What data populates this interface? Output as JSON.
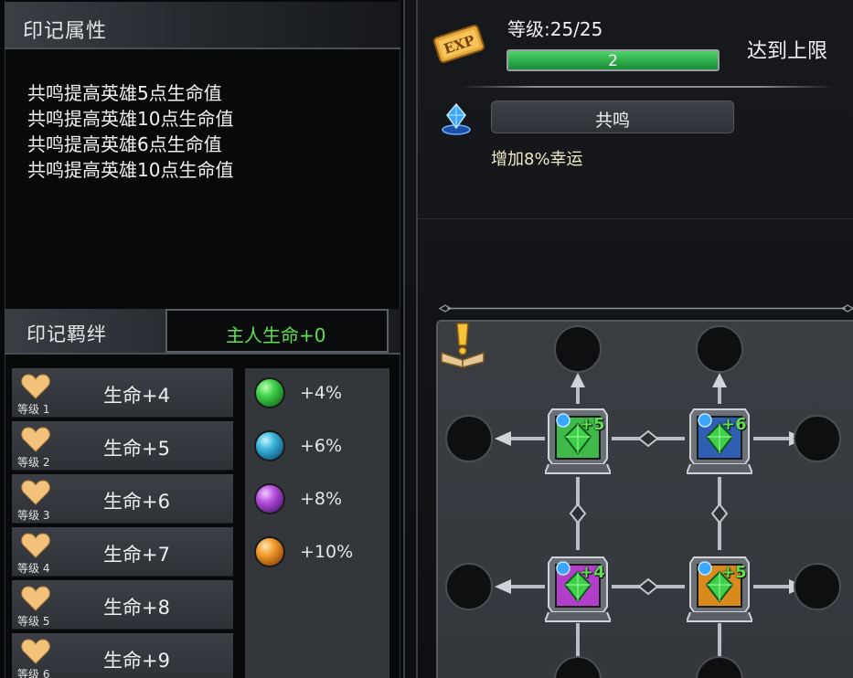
{
  "attributes": {
    "title": "印记属性",
    "lines": [
      "共鸣提高英雄5点生命值",
      "共鸣提高英雄10点生命值",
      "共鸣提高英雄6点生命值",
      "共鸣提高英雄10点生命值"
    ]
  },
  "bond": {
    "title": "印记羁绊",
    "value": "主人生命+0"
  },
  "levels": [
    {
      "label": "等级 1",
      "text": "生命+4"
    },
    {
      "label": "等级 2",
      "text": "生命+5"
    },
    {
      "label": "等级 3",
      "text": "生命+6"
    },
    {
      "label": "等级 4",
      "text": "生命+7"
    },
    {
      "label": "等级 5",
      "text": "生命+8"
    },
    {
      "label": "等级 6",
      "text": "生命+9"
    }
  ],
  "gems": [
    {
      "color": "green",
      "text": "+4%"
    },
    {
      "color": "blue",
      "text": "+6%"
    },
    {
      "color": "purple",
      "text": "+8%"
    },
    {
      "color": "orange",
      "text": "+10%"
    }
  ],
  "level_info": {
    "title": "等级:25/25",
    "exp_value": "2",
    "exp_fraction": 1.0,
    "badge": "EXP",
    "maxed_label": "达到上限"
  },
  "resonance": {
    "button_label": "共鸣",
    "description": "增加8%幸运"
  },
  "board": {
    "slots": [
      {
        "frame": "green",
        "value": "+5"
      },
      {
        "frame": "blue",
        "value": "+6"
      },
      {
        "frame": "purple",
        "value": "+4"
      },
      {
        "frame": "orange",
        "value": "+5"
      }
    ]
  },
  "colors": {
    "green": "#3fb94a",
    "blue": "#2f5fb5",
    "purple": "#b23fc9",
    "orange": "#d98a1c",
    "accent_text": "#5fe04f"
  }
}
